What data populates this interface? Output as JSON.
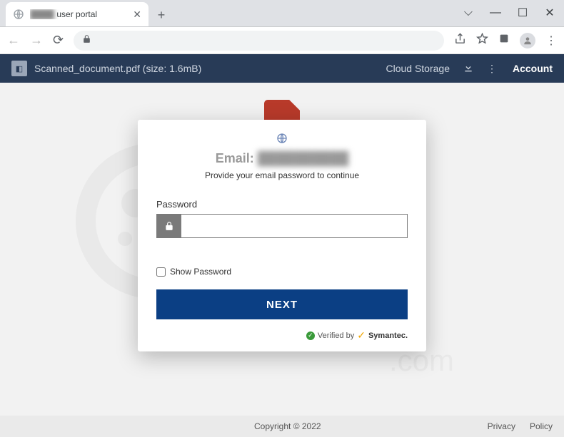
{
  "browser": {
    "tab_title_suffix": "user portal",
    "tab_title_blurred": "████",
    "window_controls": {
      "dropdown": "⌵",
      "min": "—",
      "max": "☐",
      "close": "✕"
    }
  },
  "page_header": {
    "filename": "Scanned_document.pdf (size: 1.6mB)",
    "cloud_link": "Cloud Storage",
    "account_label": "Account"
  },
  "modal": {
    "email_label": "Email:",
    "email_value_blurred": "██████████",
    "subtitle": "Provide your email password to continue",
    "password_label": "Password",
    "password_value": "",
    "show_password_label": "Show Password",
    "next_button": "NEXT",
    "verified_text": "Verified by",
    "verified_brand": "Symantec."
  },
  "footer": {
    "copyright": "Copyright © 2022",
    "privacy": "Privacy",
    "policy": "Policy"
  }
}
